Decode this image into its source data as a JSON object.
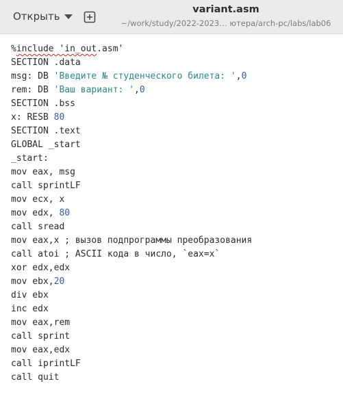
{
  "header": {
    "open_label": "Открыть",
    "title": "variant.asm",
    "subtitle": "~/work/study/2022-2023… ютера/arch-pc/labs/lab06"
  },
  "code": {
    "lines": [
      [
        {
          "t": "%"
        },
        {
          "t": "include 'in_out",
          "c": "squiggle"
        },
        {
          "t": ".asm'"
        }
      ],
      [
        {
          "t": "SECTION .data"
        }
      ],
      [
        {
          "t": "msg: DB "
        },
        {
          "t": "'Введите № студенческого билета: '",
          "c": "str"
        },
        {
          "t": ","
        },
        {
          "t": "0",
          "c": "num"
        }
      ],
      [
        {
          "t": "rem: DB "
        },
        {
          "t": "'Ваш вариант: '",
          "c": "str"
        },
        {
          "t": ","
        },
        {
          "t": "0",
          "c": "num"
        }
      ],
      [
        {
          "t": "SECTION .bss"
        }
      ],
      [
        {
          "t": "x: RESB "
        },
        {
          "t": "80",
          "c": "num"
        }
      ],
      [
        {
          "t": "SECTION .text"
        }
      ],
      [
        {
          "t": "GLOBAL _start"
        }
      ],
      [
        {
          "t": "_start:"
        }
      ],
      [
        {
          "t": "mov eax, msg"
        }
      ],
      [
        {
          "t": "call sprintLF"
        }
      ],
      [
        {
          "t": "mov ecx, x"
        }
      ],
      [
        {
          "t": "mov edx, "
        },
        {
          "t": "80",
          "c": "num"
        }
      ],
      [
        {
          "t": "call sread"
        }
      ],
      [
        {
          "t": "mov eax,x ; вызов подпрограммы преобразования"
        }
      ],
      [
        {
          "t": "call atoi ; ASCII кода в число, `eax=x`"
        }
      ],
      [
        {
          "t": "xor edx,edx"
        }
      ],
      [
        {
          "t": "mov ebx,"
        },
        {
          "t": "20",
          "c": "num"
        }
      ],
      [
        {
          "t": "div ebx"
        }
      ],
      [
        {
          "t": "inc edx"
        }
      ],
      [
        {
          "t": "mov eax,rem"
        }
      ],
      [
        {
          "t": "call sprint"
        }
      ],
      [
        {
          "t": "mov eax,edx"
        }
      ],
      [
        {
          "t": "call iprintLF"
        }
      ],
      [
        {
          "t": "call quit"
        }
      ]
    ]
  }
}
